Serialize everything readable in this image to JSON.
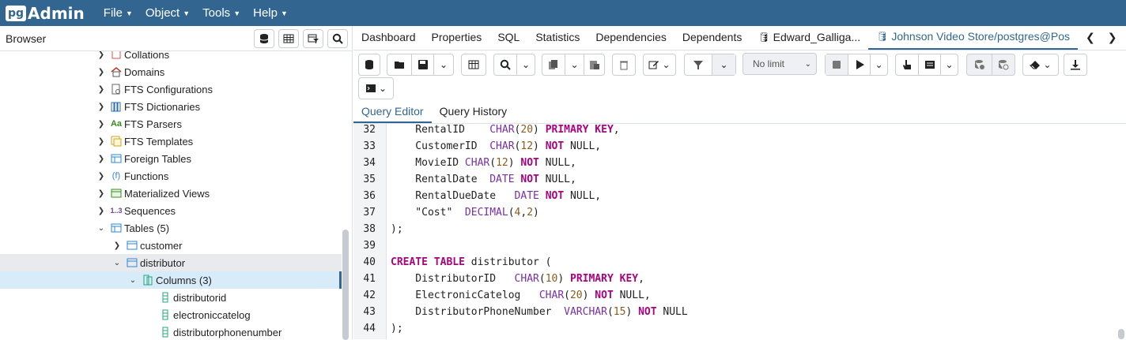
{
  "menubar": {
    "logo_pg": "pg",
    "logo_admin": "Admin",
    "items": [
      "File",
      "Object",
      "Tools",
      "Help"
    ]
  },
  "browser": {
    "title": "Browser"
  },
  "tree": [
    {
      "label": "Collations",
      "icon": "collation-icon"
    },
    {
      "label": "Domains",
      "icon": "domain-icon"
    },
    {
      "label": "FTS Configurations",
      "icon": "fts-config-icon"
    },
    {
      "label": "FTS Dictionaries",
      "icon": "fts-dictionary-icon"
    },
    {
      "label": "FTS Parsers",
      "icon": "fts-parser-icon",
      "glyph": "Aa"
    },
    {
      "label": "FTS Templates",
      "icon": "fts-template-icon"
    },
    {
      "label": "Foreign Tables",
      "icon": "foreign-table-icon"
    },
    {
      "label": "Functions",
      "icon": "function-icon",
      "glyph": "(f)"
    },
    {
      "label": "Materialized Views",
      "icon": "materialized-view-icon"
    },
    {
      "label": "Sequences",
      "icon": "sequence-icon",
      "glyph": "1..3"
    },
    {
      "label": "Tables (5)",
      "icon": "tables-icon"
    },
    {
      "label": "customer",
      "icon": "table-icon"
    },
    {
      "label": "distributor",
      "icon": "table-icon"
    },
    {
      "label": "Columns (3)",
      "icon": "columns-icon"
    },
    {
      "label": "distributorid",
      "icon": "column-icon"
    },
    {
      "label": "electroniccatelog",
      "icon": "column-icon"
    },
    {
      "label": "distributorphonenumber",
      "icon": "column-icon"
    }
  ],
  "tabs": [
    "Dashboard",
    "Properties",
    "SQL",
    "Statistics",
    "Dependencies",
    "Dependents",
    "Edward_Galliga...",
    "Johnson Video Store/postgres@Pos"
  ],
  "tab_close": "*",
  "toolbar": {
    "limit_select": "No limit"
  },
  "subtabs": [
    "Query Editor",
    "Query History"
  ],
  "editor": {
    "lines": [
      {
        "n": "32",
        "tokens": [
          [
            "p",
            "    RentalID    "
          ],
          [
            "ty",
            "CHAR"
          ],
          [
            "p",
            "("
          ],
          [
            "num",
            "20"
          ],
          [
            "p",
            ") "
          ],
          [
            "kw",
            "PRIMARY KEY"
          ],
          [
            "p",
            ","
          ]
        ]
      },
      {
        "n": "33",
        "tokens": [
          [
            "p",
            "    CustomerID  "
          ],
          [
            "ty",
            "CHAR"
          ],
          [
            "p",
            "("
          ],
          [
            "num",
            "12"
          ],
          [
            "p",
            ") "
          ],
          [
            "kw",
            "NOT"
          ],
          [
            "p",
            " NULL,"
          ]
        ]
      },
      {
        "n": "34",
        "tokens": [
          [
            "p",
            "    MovieID "
          ],
          [
            "ty",
            "CHAR"
          ],
          [
            "p",
            "("
          ],
          [
            "num",
            "12"
          ],
          [
            "p",
            ") "
          ],
          [
            "kw",
            "NOT"
          ],
          [
            "p",
            " NULL,"
          ]
        ]
      },
      {
        "n": "35",
        "tokens": [
          [
            "p",
            "    RentalDate  "
          ],
          [
            "ty",
            "DATE"
          ],
          [
            "p",
            " "
          ],
          [
            "kw",
            "NOT"
          ],
          [
            "p",
            " NULL,"
          ]
        ]
      },
      {
        "n": "36",
        "tokens": [
          [
            "p",
            "    RentalDueDate   "
          ],
          [
            "ty",
            "DATE"
          ],
          [
            "p",
            " "
          ],
          [
            "kw",
            "NOT"
          ],
          [
            "p",
            " NULL,"
          ]
        ]
      },
      {
        "n": "37",
        "tokens": [
          [
            "p",
            "    \"Cost\"  "
          ],
          [
            "ty",
            "DECIMAL"
          ],
          [
            "p",
            "("
          ],
          [
            "num",
            "4"
          ],
          [
            "p",
            ","
          ],
          [
            "num",
            "2"
          ],
          [
            "p",
            ")"
          ]
        ]
      },
      {
        "n": "38",
        "tokens": [
          [
            "p",
            ");"
          ]
        ]
      },
      {
        "n": "39",
        "tokens": []
      },
      {
        "n": "40",
        "tokens": [
          [
            "kw",
            "CREATE TABLE"
          ],
          [
            "p",
            " distributor ("
          ]
        ]
      },
      {
        "n": "41",
        "tokens": [
          [
            "p",
            "    DistributorID   "
          ],
          [
            "ty",
            "CHAR"
          ],
          [
            "p",
            "("
          ],
          [
            "num",
            "10"
          ],
          [
            "p",
            ") "
          ],
          [
            "kw",
            "PRIMARY KEY"
          ],
          [
            "p",
            ","
          ]
        ]
      },
      {
        "n": "42",
        "tokens": [
          [
            "p",
            "    ElectronicCatelog   "
          ],
          [
            "ty",
            "CHAR"
          ],
          [
            "p",
            "("
          ],
          [
            "num",
            "20"
          ],
          [
            "p",
            ") "
          ],
          [
            "kw",
            "NOT"
          ],
          [
            "p",
            " NULL,"
          ]
        ]
      },
      {
        "n": "43",
        "tokens": [
          [
            "p",
            "    DistributorPhoneNumber  "
          ],
          [
            "ty",
            "VARCHAR"
          ],
          [
            "p",
            "("
          ],
          [
            "num",
            "15"
          ],
          [
            "p",
            ") "
          ],
          [
            "kw",
            "NOT"
          ],
          [
            "p",
            " NULL"
          ]
        ]
      },
      {
        "n": "44",
        "tokens": [
          [
            "p",
            ");"
          ]
        ]
      }
    ]
  },
  "colors": {
    "brand": "#326690",
    "keyword": "#a9037f",
    "type": "#7a2ea5",
    "number": "#8c5b1a",
    "selected_row": "#d8ebf8"
  }
}
